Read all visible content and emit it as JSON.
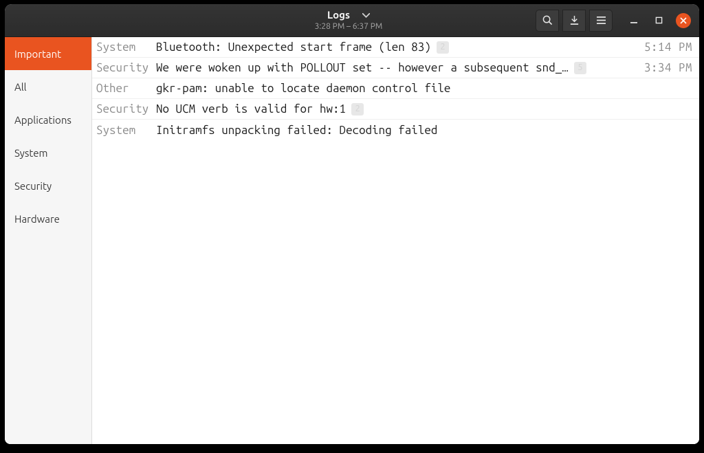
{
  "header": {
    "title": "Logs",
    "subtitle": "3:28 PM –  6:37 PM"
  },
  "sidebar": {
    "items": [
      {
        "label": "Important",
        "selected": true
      },
      {
        "label": "All",
        "selected": false
      },
      {
        "label": "Applications",
        "selected": false
      },
      {
        "label": "System",
        "selected": false
      },
      {
        "label": "Security",
        "selected": false
      },
      {
        "label": "Hardware",
        "selected": false
      }
    ]
  },
  "logs": [
    {
      "category": "System",
      "message": "Bluetooth: Unexpected start frame (len 83)",
      "badge": "2",
      "time": "5:14 PM"
    },
    {
      "category": "Security",
      "message": "We were woken up with POLLOUT set -- however a subsequent snd_…",
      "badge": "5",
      "time": "3:34 PM"
    },
    {
      "category": "Other",
      "message": "gkr-pam: unable to locate daemon control file",
      "badge": "",
      "time": ""
    },
    {
      "category": "Security",
      "message": "No UCM verb is valid for hw:1",
      "badge": "2",
      "time": ""
    },
    {
      "category": "System",
      "message": "Initramfs unpacking failed: Decoding failed",
      "badge": "",
      "time": ""
    }
  ],
  "colors": {
    "accent": "#e95420",
    "headerBg": "#2e2e2e",
    "sidebarBg": "#f6f6f6",
    "muted": "#8b8b8b"
  }
}
